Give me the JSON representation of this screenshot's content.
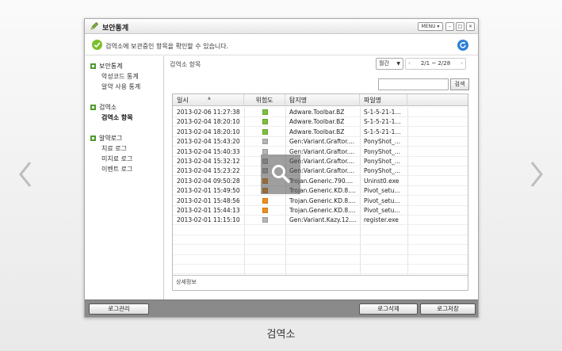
{
  "window": {
    "title": "보안통계",
    "menu_label": "MENU ▾",
    "min_label": "–",
    "max_label": "□",
    "close_label": "×"
  },
  "notice": {
    "text": "검역소에 보관중인 항목을 확인할 수 있습니다."
  },
  "sidebar": {
    "groups": [
      {
        "label": "보안통계",
        "items": [
          "악성코드 통계",
          "알약 사용 통계"
        ]
      },
      {
        "label": "검역소",
        "items": [
          "검역소 항목"
        ]
      },
      {
        "label": "알약로그",
        "items": [
          "치료 로그",
          "미치료 로그",
          "이벤트 로그"
        ]
      }
    ],
    "active_item": "검역소 항목"
  },
  "main": {
    "breadcrumb": "검역소 항목",
    "period_select": "월간",
    "pager": {
      "prev": "‹",
      "range": "2/1 ~ 2/28",
      "next": "›"
    },
    "search_placeholder": "",
    "search_button": "검색",
    "detail_label": "상세정보"
  },
  "table": {
    "columns": [
      "일시",
      "위험도",
      "탐지명",
      "파일명"
    ],
    "rows": [
      {
        "date": "2013-02-06 11:27:38",
        "risk": "green",
        "name": "Adware.Toolbar.BZ",
        "file": "S-1-5-21-1..."
      },
      {
        "date": "2013-02-04 18:20:10",
        "risk": "green",
        "name": "Adware.Toolbar.BZ",
        "file": "S-1-5-21-1..."
      },
      {
        "date": "2013-02-04 18:20:10",
        "risk": "green",
        "name": "Adware.Toolbar.BZ",
        "file": "S-1-5-21-1..."
      },
      {
        "date": "2013-02-04 15:43:20",
        "risk": "gray",
        "name": "Gen:Variant.Graftor....",
        "file": "PonyShot_..."
      },
      {
        "date": "2013-02-04 15:40:33",
        "risk": "gray",
        "name": "Gen:Variant.Graftor....",
        "file": "PonyShot_..."
      },
      {
        "date": "2013-02-04 15:32:12",
        "risk": "gray",
        "name": "Gen:Variant.Graftor....",
        "file": "PonyShot_..."
      },
      {
        "date": "2013-02-04 15:23:22",
        "risk": "gray",
        "name": "Gen:Variant.Graftor....",
        "file": "PonyShot_..."
      },
      {
        "date": "2013-02-04 09:50:28",
        "risk": "orange",
        "name": "Trojan.Generic.790....",
        "file": "Uninst0.exe"
      },
      {
        "date": "2013-02-01 15:49:50",
        "risk": "orange",
        "name": "Trojan.Generic.KD.8....",
        "file": "Pivot_setu..."
      },
      {
        "date": "2013-02-01 15:48:56",
        "risk": "orange",
        "name": "Trojan.Generic.KD.8....",
        "file": "Pivot_setu..."
      },
      {
        "date": "2013-02-01 15:44:13",
        "risk": "orange",
        "name": "Trojan.Generic.KD.8....",
        "file": "Pivot_setu..."
      },
      {
        "date": "2013-02-01 11:15:10",
        "risk": "gray",
        "name": "Gen:Variant.Kazy.12....",
        "file": "register.exe"
      }
    ],
    "risk_colors": {
      "green": "#7cbf3c",
      "gray": "#b5b5b5",
      "orange": "#f08f1c"
    }
  },
  "footer": {
    "log_manage": "로그관리",
    "log_delete": "로그삭제",
    "log_save": "로그저장"
  },
  "caption": "검역소",
  "colors": {
    "accent_green": "#4e9a2b",
    "refresh_blue": "#2f7fd6",
    "footer_bg": "#8a8a8a"
  }
}
